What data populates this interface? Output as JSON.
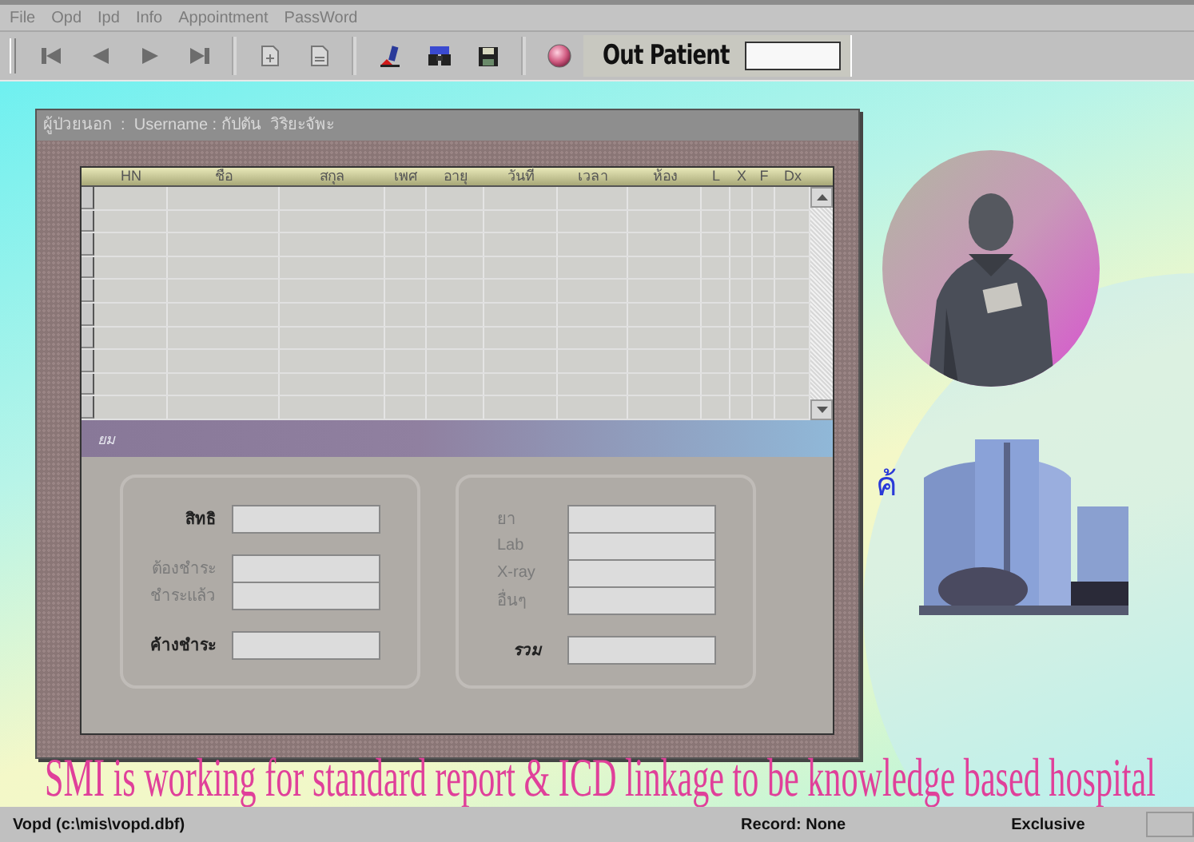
{
  "menu": [
    "File",
    "Opd",
    "Ipd",
    "Info",
    "Appointment",
    "PassWord"
  ],
  "toolbar": {
    "buttons": [
      {
        "kind": "first"
      },
      {
        "kind": "prev"
      },
      {
        "kind": "next"
      },
      {
        "kind": "last"
      },
      {
        "kind": "sep"
      },
      {
        "kind": "new-doc"
      },
      {
        "kind": "doc"
      },
      {
        "kind": "sep"
      },
      {
        "kind": "edit"
      },
      {
        "kind": "find"
      },
      {
        "kind": "save"
      },
      {
        "kind": "sep"
      },
      {
        "kind": "ball"
      }
    ],
    "mode_label": "Out Patient"
  },
  "window": {
    "title": "ผู้ป่วยนอก  :  Username : กัปตัน  วิริยะจัพะ"
  },
  "table": {
    "columns": [
      "HN",
      "ชื่อ",
      "สกุล",
      "เพศ",
      "อายุ",
      "วันที่",
      "เวลา",
      "ห้อง",
      "L",
      "X",
      "F",
      "Dx"
    ]
  },
  "band": {
    "label": "ยม"
  },
  "left_group": [
    {
      "label": "สิทธิ",
      "kind": "bold"
    },
    {
      "kind": "gap"
    },
    {
      "label": "ต้องชำระ",
      "kind": "plain"
    },
    {
      "label": "ชำระแล้ว",
      "kind": "plain"
    },
    {
      "kind": "gap"
    },
    {
      "label": "ค้างชำระ",
      "kind": "bold"
    }
  ],
  "right_group": [
    {
      "label": "ยา",
      "kind": "plain"
    },
    {
      "label": "Lab",
      "kind": "plain"
    },
    {
      "label": "X-ray",
      "kind": "plain"
    },
    {
      "label": "อื่นๆ",
      "kind": "plain"
    },
    {
      "kind": "gap"
    },
    {
      "label": "รวม",
      "kind": "italic"
    }
  ],
  "desktop": {
    "glyph": "ค้",
    "marquee": "SMI is working for standard report & ICD linkage to be knowledge based hospital"
  },
  "status_bar": {
    "file": "Vopd (c:\\mis\\vopd.dbf)",
    "record": "Record: None",
    "mode": "Exclusive"
  }
}
